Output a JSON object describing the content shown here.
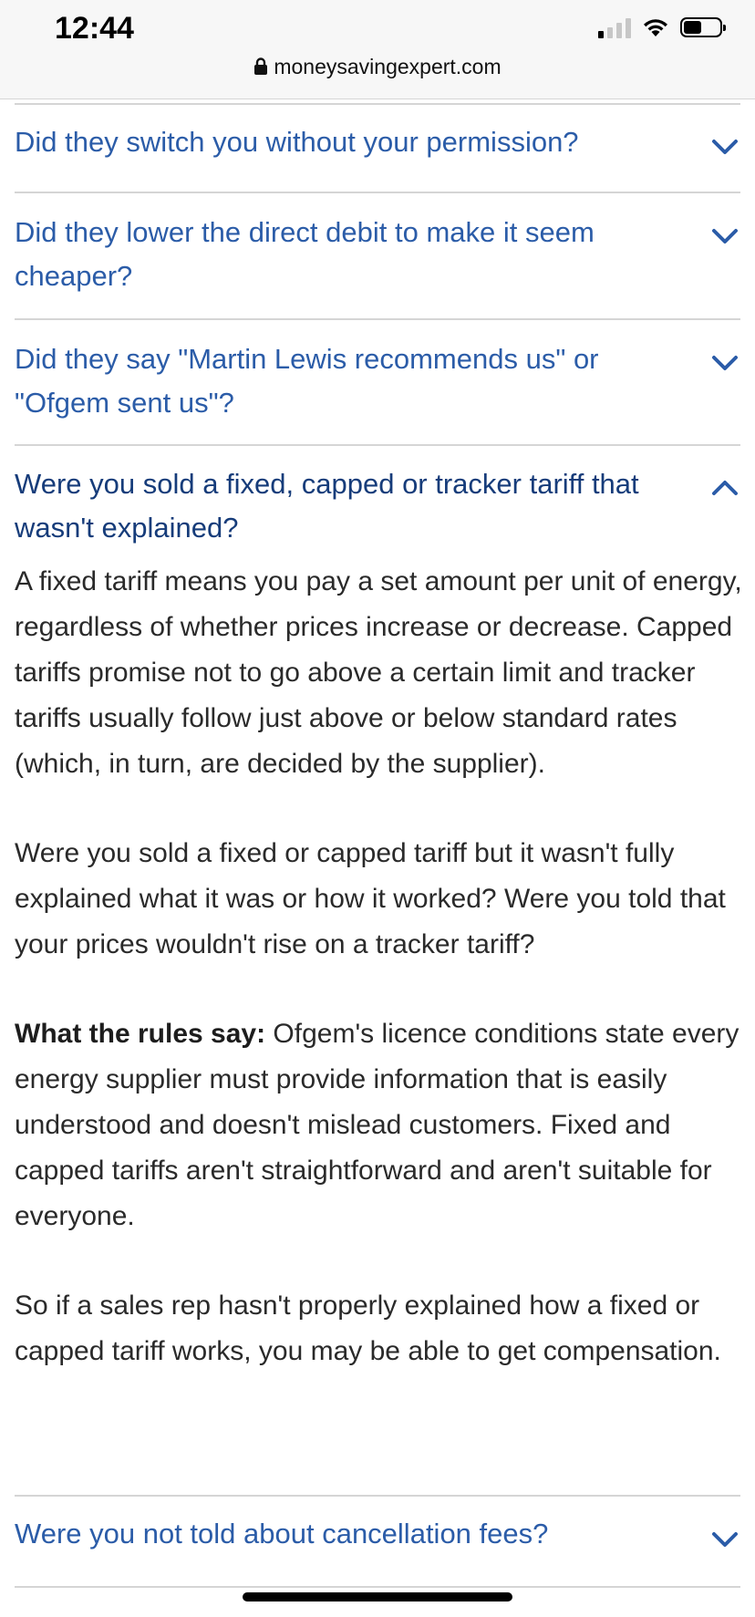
{
  "status_bar": {
    "time": "12:44",
    "url": "moneysavingexpert.com",
    "signal_bars_on": 1,
    "battery_level": 0.5
  },
  "accordion": {
    "items": [
      {
        "question": "Did they switch you without your permission?",
        "expanded": false
      },
      {
        "question": "Did they lower the direct debit to make it seem cheaper?",
        "expanded": false
      },
      {
        "question": "Did they say \"Martin Lewis recommends us\" or \"Ofgem sent us\"?",
        "expanded": false
      },
      {
        "question": "Were you sold a fixed, capped or tracker tariff that wasn't explained?",
        "expanded": true,
        "paragraphs": [
          "A fixed tariff means you pay a set amount per unit of energy, regardless of whether prices increase or decrease. Capped tariffs promise not to go above a certain limit and tracker tariffs usually follow just above or below standard rates (which, in turn, are decided by the supplier).",
          "Were you sold a fixed or capped tariff but it wasn't fully explained what it was or how it worked? Were you told that your prices wouldn't rise on a tracker tariff?"
        ],
        "rules_label": "What the rules say:",
        "rules_text": " Ofgem's licence conditions state every energy supplier must provide information that is easily understood and doesn't mislead customers. Fixed and capped tariffs aren't straightforward and aren't suitable for everyone.",
        "closing": "So if a sales rep hasn't properly explained how a fixed or capped tariff works, you may be able to get compensation."
      },
      {
        "question": "Were you not told about cancellation fees?",
        "expanded": false
      }
    ]
  },
  "colors": {
    "link_blue": "#2b5ca8",
    "open_blue": "#163c7a",
    "divider": "#d5d5d5"
  }
}
